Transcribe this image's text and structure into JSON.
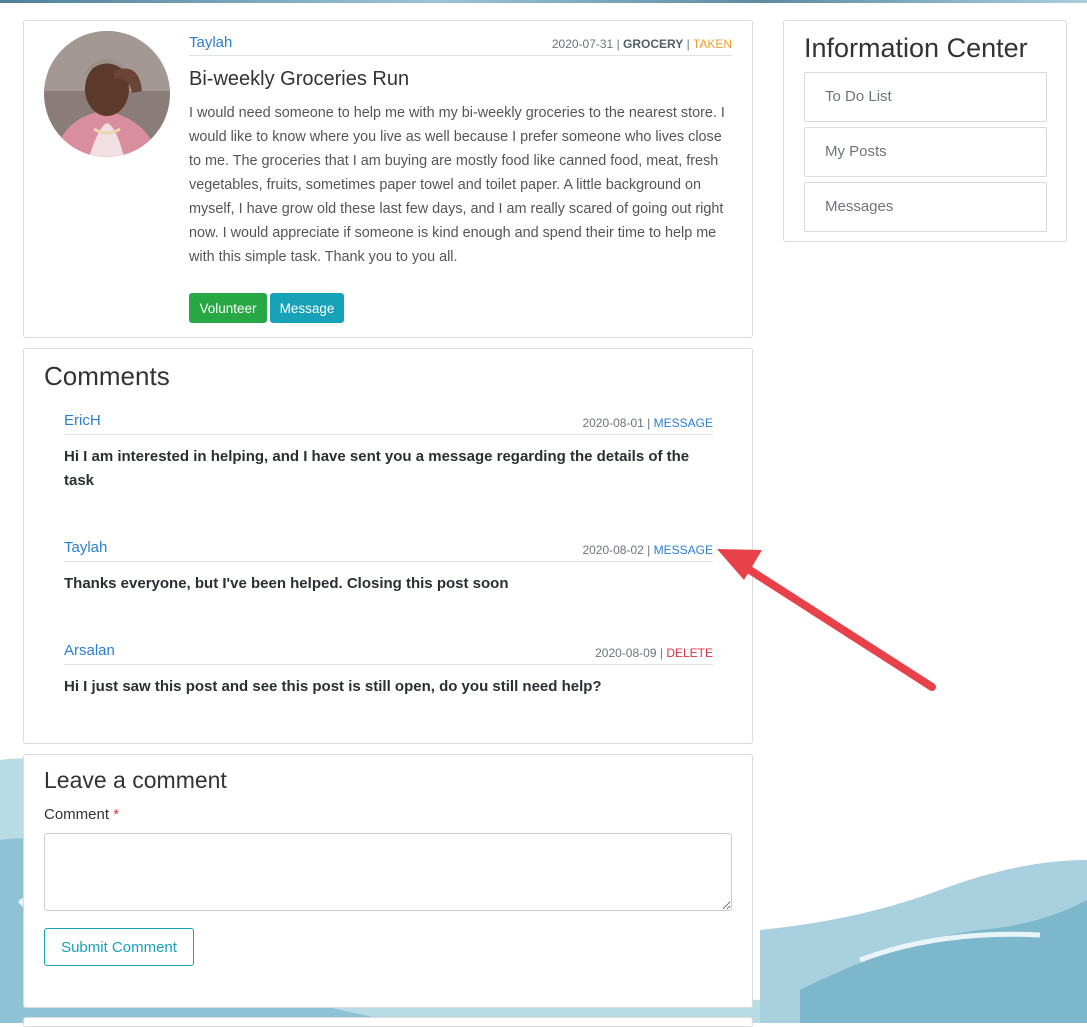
{
  "post": {
    "author": "Taylah",
    "date": "2020-07-31",
    "category": "GROCERY",
    "status": "TAKEN",
    "title": "Bi-weekly Groceries Run",
    "body": "I would need someone to help me with my bi-weekly groceries to the nearest store. I would like to know where you live as well because I prefer someone who lives close to me. The groceries that I am buying are mostly food like canned food, meat, fresh vegetables, fruits, sometimes paper towel and toilet paper. A little background on myself, I have grow old these last few days, and I am really scared of going out right now. I would appreciate if someone is kind enough and spend their time to help me with this simple task. Thank you to you all.",
    "volunteer_label": "Volunteer",
    "message_label": "Message",
    "separator": "|"
  },
  "comments": {
    "title": "Comments",
    "items": [
      {
        "author": "EricH",
        "date": "2020-08-01",
        "action": "MESSAGE",
        "text": "Hi I am interested in helping, and I have sent you a message regarding the details of the task"
      },
      {
        "author": "Taylah",
        "date": "2020-08-02",
        "action": "MESSAGE",
        "text": "Thanks everyone, but I've been helped. Closing this post soon"
      },
      {
        "author": "Arsalan",
        "date": "2020-08-09",
        "action": "DELETE",
        "text": "Hi I just saw this post and see this post is still open, do you still need help?"
      }
    ]
  },
  "leave_comment": {
    "title": "Leave a comment",
    "label": "Comment",
    "required_mark": "*",
    "value": "",
    "submit_label": "Submit Comment"
  },
  "info_center": {
    "title": "Information Center",
    "items": [
      "To Do List",
      "My Posts",
      "Messages"
    ]
  },
  "colors": {
    "link_blue": "#2a7fd4",
    "volunteer_green": "#28a745",
    "message_teal": "#17a2b8",
    "taken_orange": "#f0a030",
    "delete_red": "#dc3545",
    "annotation_arrow": "#e8414a"
  }
}
